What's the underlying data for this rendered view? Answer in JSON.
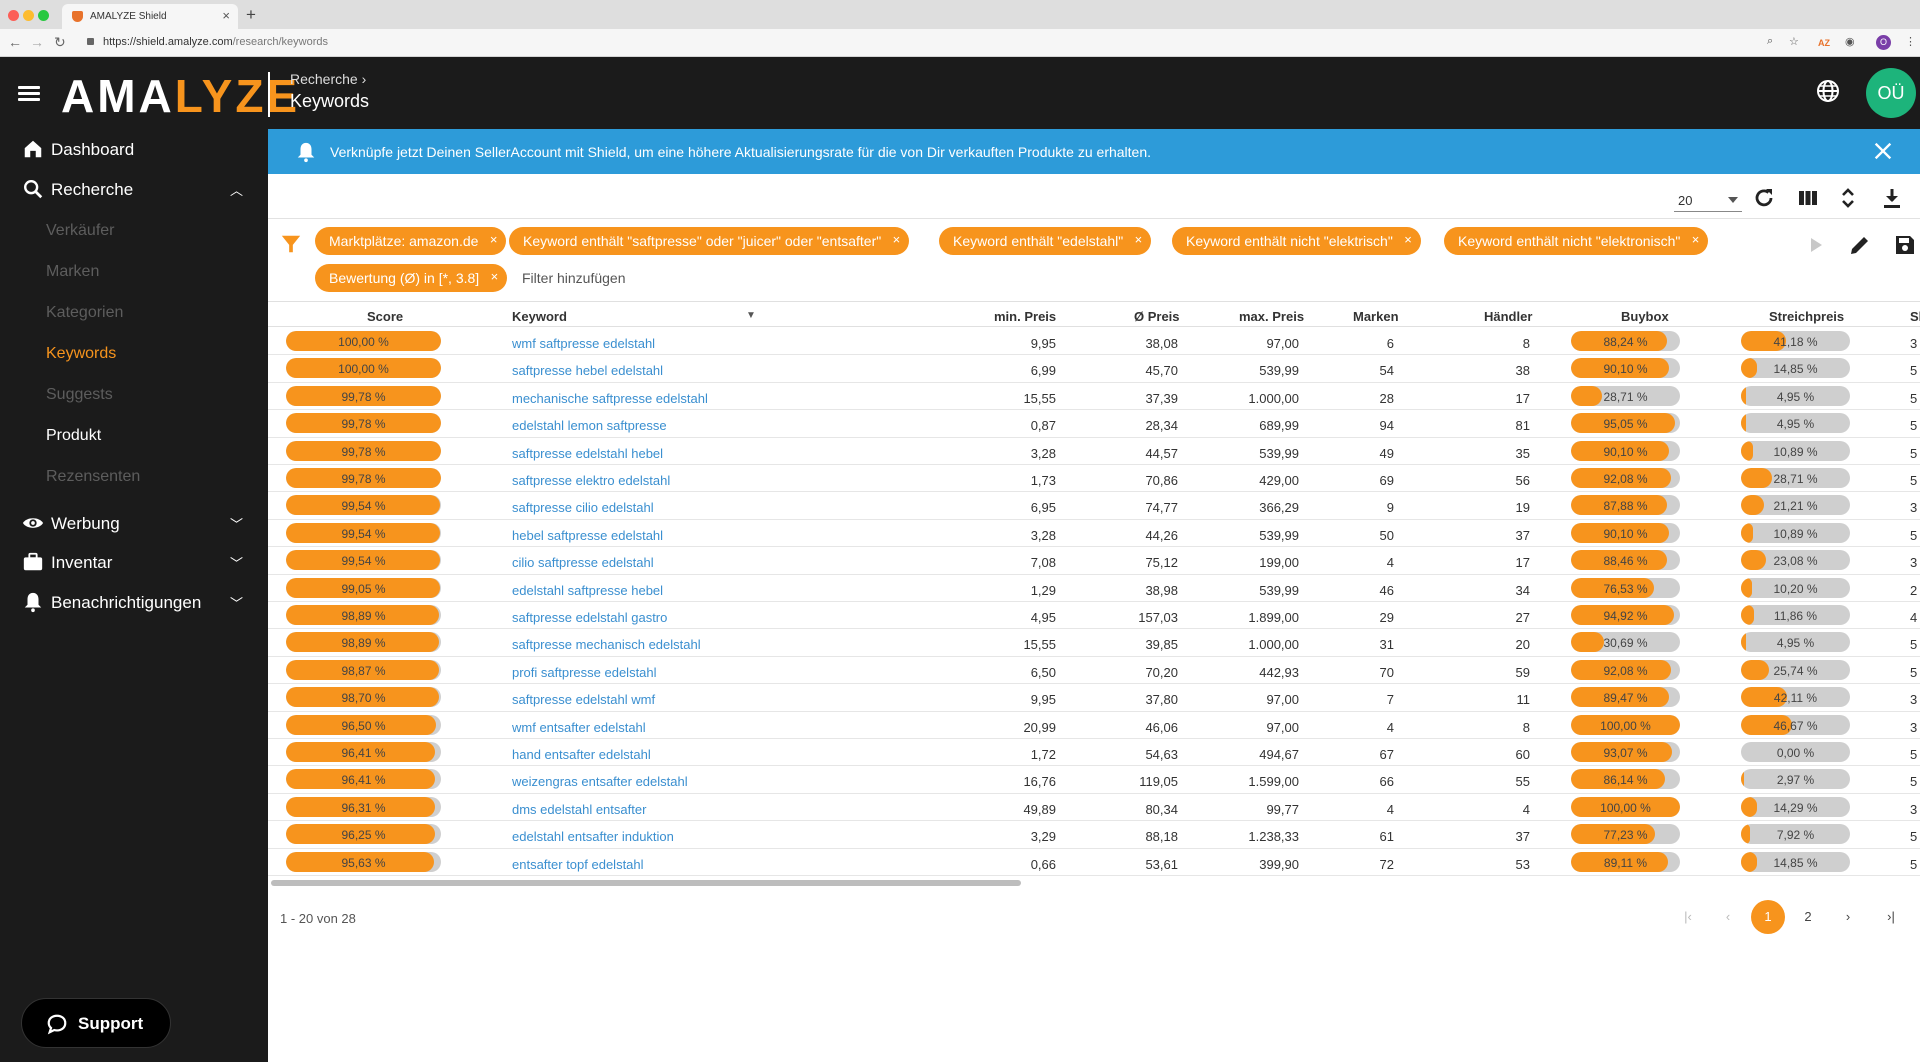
{
  "browser": {
    "tab_title": "AMALYZE Shield",
    "new_tab": "+",
    "url_host": "https://shield.amalyze.com",
    "url_path": "/research/keywords",
    "ext_az": "AZ",
    "profile_initial": "O"
  },
  "header": {
    "logo_a": "AMA",
    "logo_b": "LYZE",
    "breadcrumb": "Recherche ›",
    "title": "Keywords",
    "avatar": "OÜ"
  },
  "sidebar": {
    "dashboard": "Dashboard",
    "recherche": "Recherche",
    "sub_items": [
      "Verkäufer",
      "Marken",
      "Kategorien",
      "Keywords",
      "Suggests",
      "Produkt",
      "Rezensenten"
    ],
    "werbung": "Werbung",
    "inventar": "Inventar",
    "benachrichtigungen": "Benachrichtigungen",
    "support": "Support"
  },
  "banner": {
    "text": "Verknüpfe jetzt Deinen SellerAccount mit Shield, um eine höhere Aktualisierungsrate für die von Dir verkauften Produkte zu erhalten."
  },
  "toolbar": {
    "page_size": "20"
  },
  "filters": {
    "chips": [
      "Marktplätze: amazon.de",
      "Keyword enthält \"saftpresse\" oder \"juicer\" oder \"entsafter\"",
      "Keyword enthält \"edelstahl\"",
      "Keyword enthält nicht \"elektrisch\"",
      "Keyword enthält nicht \"elektronisch\"",
      "Bewertung (Ø) in [*, 3.8]"
    ],
    "add_label": "Filter hinzufügen"
  },
  "table": {
    "columns": [
      "Score",
      "Keyword",
      "min. Preis",
      "Ø Preis",
      "max. Preis",
      "Marken",
      "Händler",
      "Buybox",
      "Streichpreis",
      "Sh"
    ],
    "rows": [
      {
        "score": "100,00 %",
        "score_v": 100.0,
        "keyword": "wmf saftpresse edelstahl",
        "min": "9,95",
        "avg": "38,08",
        "max": "97,00",
        "marken": "6",
        "haendler": "8",
        "buybox": "88,24 %",
        "buybox_v": 88.24,
        "streich": "41,18 %",
        "streich_v": 41.18,
        "extra": "3"
      },
      {
        "score": "100,00 %",
        "score_v": 100.0,
        "keyword": "saftpresse hebel edelstahl",
        "min": "6,99",
        "avg": "45,70",
        "max": "539,99",
        "marken": "54",
        "haendler": "38",
        "buybox": "90,10 %",
        "buybox_v": 90.1,
        "streich": "14,85 %",
        "streich_v": 14.85,
        "extra": "5"
      },
      {
        "score": "99,78 %",
        "score_v": 99.78,
        "keyword": "mechanische saftpresse edelstahl",
        "min": "15,55",
        "avg": "37,39",
        "max": "1.000,00",
        "marken": "28",
        "haendler": "17",
        "buybox": "28,71 %",
        "buybox_v": 28.71,
        "streich": "4,95 %",
        "streich_v": 4.95,
        "extra": "5"
      },
      {
        "score": "99,78 %",
        "score_v": 99.78,
        "keyword": "edelstahl lemon saftpresse",
        "min": "0,87",
        "avg": "28,34",
        "max": "689,99",
        "marken": "94",
        "haendler": "81",
        "buybox": "95,05 %",
        "buybox_v": 95.05,
        "streich": "4,95 %",
        "streich_v": 4.95,
        "extra": "5"
      },
      {
        "score": "99,78 %",
        "score_v": 99.78,
        "keyword": "saftpresse edelstahl hebel",
        "min": "3,28",
        "avg": "44,57",
        "max": "539,99",
        "marken": "49",
        "haendler": "35",
        "buybox": "90,10 %",
        "buybox_v": 90.1,
        "streich": "10,89 %",
        "streich_v": 10.89,
        "extra": "5"
      },
      {
        "score": "99,78 %",
        "score_v": 99.78,
        "keyword": "saftpresse elektro edelstahl",
        "min": "1,73",
        "avg": "70,86",
        "max": "429,00",
        "marken": "69",
        "haendler": "56",
        "buybox": "92,08 %",
        "buybox_v": 92.08,
        "streich": "28,71 %",
        "streich_v": 28.71,
        "extra": "5"
      },
      {
        "score": "99,54 %",
        "score_v": 99.54,
        "keyword": "saftpresse cilio edelstahl",
        "min": "6,95",
        "avg": "74,77",
        "max": "366,29",
        "marken": "9",
        "haendler": "19",
        "buybox": "87,88 %",
        "buybox_v": 87.88,
        "streich": "21,21 %",
        "streich_v": 21.21,
        "extra": "3"
      },
      {
        "score": "99,54 %",
        "score_v": 99.54,
        "keyword": "hebel saftpresse edelstahl",
        "min": "3,28",
        "avg": "44,26",
        "max": "539,99",
        "marken": "50",
        "haendler": "37",
        "buybox": "90,10 %",
        "buybox_v": 90.1,
        "streich": "10,89 %",
        "streich_v": 10.89,
        "extra": "5"
      },
      {
        "score": "99,54 %",
        "score_v": 99.54,
        "keyword": "cilio saftpresse edelstahl",
        "min": "7,08",
        "avg": "75,12",
        "max": "199,00",
        "marken": "4",
        "haendler": "17",
        "buybox": "88,46 %",
        "buybox_v": 88.46,
        "streich": "23,08 %",
        "streich_v": 23.08,
        "extra": "3"
      },
      {
        "score": "99,05 %",
        "score_v": 99.05,
        "keyword": "edelstahl saftpresse hebel",
        "min": "1,29",
        "avg": "38,98",
        "max": "539,99",
        "marken": "46",
        "haendler": "34",
        "buybox": "76,53 %",
        "buybox_v": 76.53,
        "streich": "10,20 %",
        "streich_v": 10.2,
        "extra": "2"
      },
      {
        "score": "98,89 %",
        "score_v": 98.89,
        "keyword": "saftpresse edelstahl gastro",
        "min": "4,95",
        "avg": "157,03",
        "max": "1.899,00",
        "marken": "29",
        "haendler": "27",
        "buybox": "94,92 %",
        "buybox_v": 94.92,
        "streich": "11,86 %",
        "streich_v": 11.86,
        "extra": "4"
      },
      {
        "score": "98,89 %",
        "score_v": 98.89,
        "keyword": "saftpresse mechanisch edelstahl",
        "min": "15,55",
        "avg": "39,85",
        "max": "1.000,00",
        "marken": "31",
        "haendler": "20",
        "buybox": "30,69 %",
        "buybox_v": 30.69,
        "streich": "4,95 %",
        "streich_v": 4.95,
        "extra": "5"
      },
      {
        "score": "98,87 %",
        "score_v": 98.87,
        "keyword": "profi saftpresse edelstahl",
        "min": "6,50",
        "avg": "70,20",
        "max": "442,93",
        "marken": "70",
        "haendler": "59",
        "buybox": "92,08 %",
        "buybox_v": 92.08,
        "streich": "25,74 %",
        "streich_v": 25.74,
        "extra": "5"
      },
      {
        "score": "98,70 %",
        "score_v": 98.7,
        "keyword": "saftpresse edelstahl wmf",
        "min": "9,95",
        "avg": "37,80",
        "max": "97,00",
        "marken": "7",
        "haendler": "11",
        "buybox": "89,47 %",
        "buybox_v": 89.47,
        "streich": "42,11 %",
        "streich_v": 42.11,
        "extra": "3"
      },
      {
        "score": "96,50 %",
        "score_v": 96.5,
        "keyword": "wmf entsafter edelstahl",
        "min": "20,99",
        "avg": "46,06",
        "max": "97,00",
        "marken": "4",
        "haendler": "8",
        "buybox": "100,00 %",
        "buybox_v": 100.0,
        "streich": "46,67 %",
        "streich_v": 46.67,
        "extra": "3"
      },
      {
        "score": "96,41 %",
        "score_v": 96.41,
        "keyword": "hand entsafter edelstahl",
        "min": "1,72",
        "avg": "54,63",
        "max": "494,67",
        "marken": "67",
        "haendler": "60",
        "buybox": "93,07 %",
        "buybox_v": 93.07,
        "streich": "0,00 %",
        "streich_v": 0.0,
        "extra": "5"
      },
      {
        "score": "96,41 %",
        "score_v": 96.41,
        "keyword": "weizengras entsafter edelstahl",
        "min": "16,76",
        "avg": "119,05",
        "max": "1.599,00",
        "marken": "66",
        "haendler": "55",
        "buybox": "86,14 %",
        "buybox_v": 86.14,
        "streich": "2,97 %",
        "streich_v": 2.97,
        "extra": "5"
      },
      {
        "score": "96,31 %",
        "score_v": 96.31,
        "keyword": "dms edelstahl entsafter",
        "min": "49,89",
        "avg": "80,34",
        "max": "99,77",
        "marken": "4",
        "haendler": "4",
        "buybox": "100,00 %",
        "buybox_v": 100.0,
        "streich": "14,29 %",
        "streich_v": 14.29,
        "extra": "3"
      },
      {
        "score": "96,25 %",
        "score_v": 96.25,
        "keyword": "edelstahl entsafter induktion",
        "min": "3,29",
        "avg": "88,18",
        "max": "1.238,33",
        "marken": "61",
        "haendler": "37",
        "buybox": "77,23 %",
        "buybox_v": 77.23,
        "streich": "7,92 %",
        "streich_v": 7.92,
        "extra": "5"
      },
      {
        "score": "95,63 %",
        "score_v": 95.63,
        "keyword": "entsafter topf edelstahl",
        "min": "0,66",
        "avg": "53,61",
        "max": "399,90",
        "marken": "72",
        "haendler": "53",
        "buybox": "89,11 %",
        "buybox_v": 89.11,
        "streich": "14,85 %",
        "streich_v": 14.85,
        "extra": "5"
      }
    ]
  },
  "footer": {
    "range": "1 - 20 von 28",
    "pages": [
      "1",
      "2"
    ]
  },
  "colors": {
    "accent": "#f7941d",
    "banner": "#2d9bd9",
    "sidebar": "#1b1b1b",
    "avatar": "#1db47b",
    "link": "#3a8fd0"
  }
}
